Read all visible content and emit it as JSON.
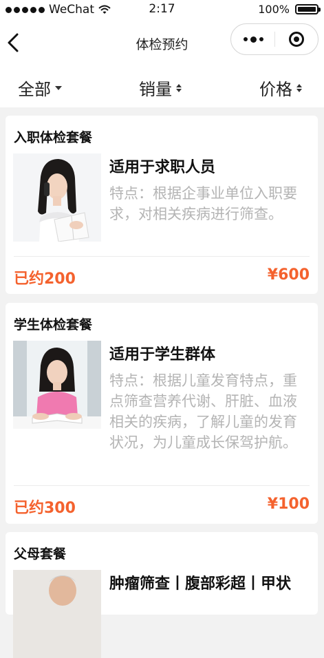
{
  "status_bar": {
    "carrier": "WeChat",
    "time": "2:17",
    "battery": "100%",
    "battery_level": 1.0
  },
  "nav": {
    "title": "体检预约"
  },
  "filters": [
    {
      "label": "全部",
      "icon": "dropdown-caret-icon"
    },
    {
      "label": "销量",
      "icon": "sort-icon"
    },
    {
      "label": "价格",
      "icon": "sort-icon"
    }
  ],
  "packages": [
    {
      "title": "入职体检套餐",
      "subtitle": "适用于求职人员",
      "description": "特点：根据企事业单位入职要求，对相关疾病进行筛查。",
      "booked": "已约200",
      "price": "¥600",
      "image": "woman-on-phone-with-book"
    },
    {
      "title": "学生体检套餐",
      "subtitle": "适用于学生群体",
      "description": "特点：根据儿童发育特点，重点筛查营养代谢、肝脏、血液相关的疾病，了解儿童的发育状况，为儿童成长保驾护航。",
      "booked": "已约300",
      "price": "¥100",
      "image": "student-girl-at-desk"
    },
    {
      "title": "父母套餐",
      "subtitle": "肿瘤筛查丨腹部彩超丨甲状",
      "image": "elderly-man"
    }
  ],
  "colors": {
    "accent": "#f4622e",
    "description_text": "#b4b4b4",
    "page_background": "#f2f2f2"
  }
}
